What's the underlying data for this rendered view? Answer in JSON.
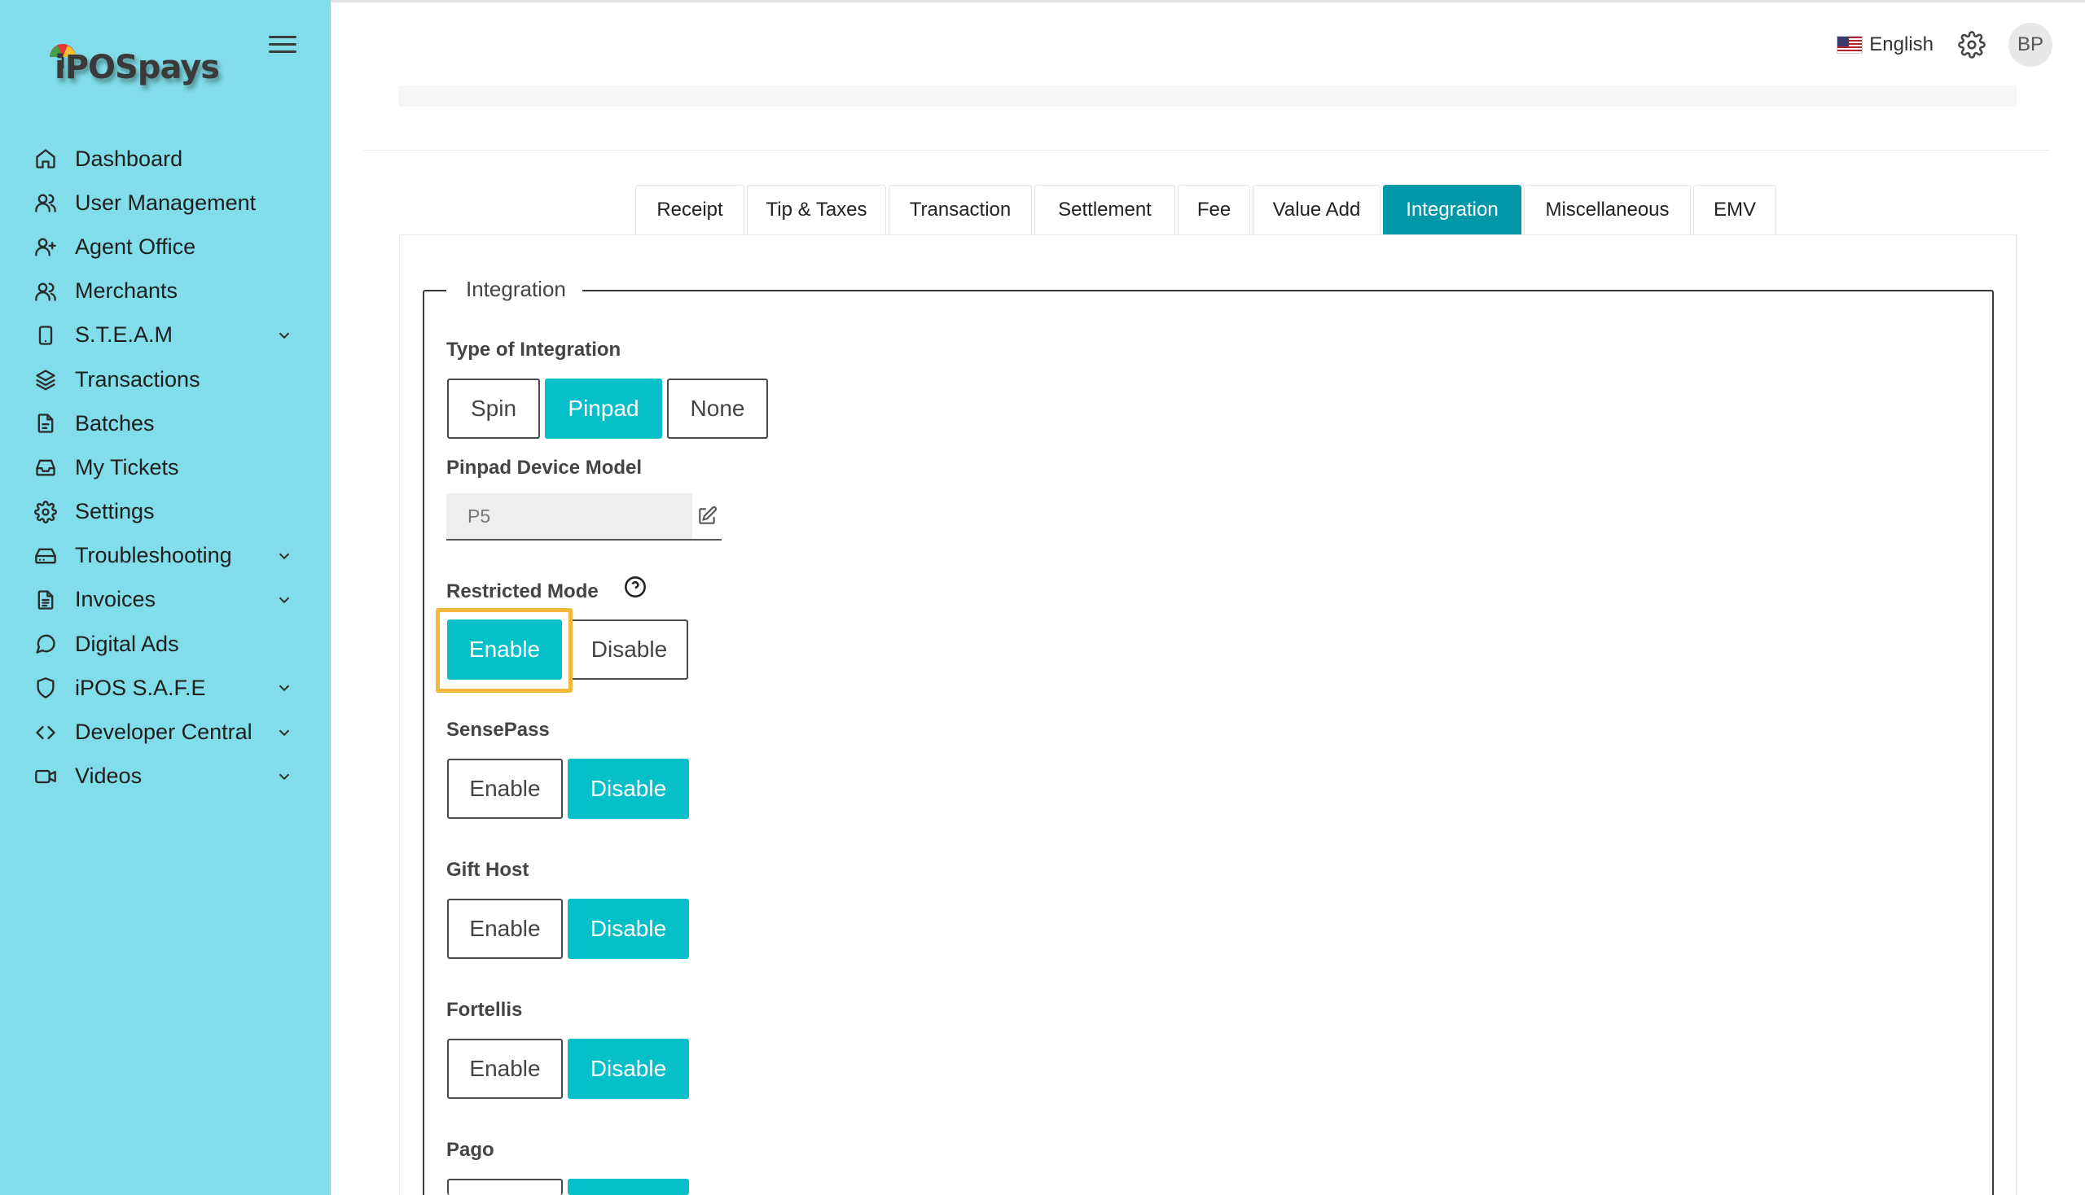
{
  "brand": {
    "logo_text": "iPOSpays"
  },
  "sidebar": {
    "items": [
      {
        "label": "Dashboard",
        "icon": "home-icon",
        "expandable": false
      },
      {
        "label": "User Management",
        "icon": "users-icon",
        "expandable": false
      },
      {
        "label": "Agent Office",
        "icon": "user-plus-icon",
        "expandable": false
      },
      {
        "label": "Merchants",
        "icon": "users-icon",
        "expandable": false
      },
      {
        "label": "S.T.E.A.M",
        "icon": "tablet-icon",
        "expandable": true
      },
      {
        "label": "Transactions",
        "icon": "layers-icon",
        "expandable": false
      },
      {
        "label": "Batches",
        "icon": "file-icon",
        "expandable": false
      },
      {
        "label": "My Tickets",
        "icon": "inbox-icon",
        "expandable": false
      },
      {
        "label": "Settings",
        "icon": "gear-icon",
        "expandable": false
      },
      {
        "label": "Troubleshooting",
        "icon": "hard-drive-icon",
        "expandable": true
      },
      {
        "label": "Invoices",
        "icon": "file-text-icon",
        "expandable": true
      },
      {
        "label": "Digital Ads",
        "icon": "message-circle-icon",
        "expandable": false
      },
      {
        "label": "iPOS S.A.F.E",
        "icon": "shield-icon",
        "expandable": true
      },
      {
        "label": "Developer Central",
        "icon": "code-icon",
        "expandable": true
      },
      {
        "label": "Videos",
        "icon": "video-icon",
        "expandable": true
      }
    ]
  },
  "header": {
    "language": "English",
    "avatar_initials": "BP"
  },
  "tabs": [
    {
      "label": "Receipt",
      "active": false
    },
    {
      "label": "Tip & Taxes",
      "active": false
    },
    {
      "label": "Transaction",
      "active": false
    },
    {
      "label": "Settlement",
      "active": false
    },
    {
      "label": "Fee",
      "active": false
    },
    {
      "label": "Value Add",
      "active": false
    },
    {
      "label": "Integration",
      "active": true
    },
    {
      "label": "Miscellaneous",
      "active": false
    },
    {
      "label": "EMV",
      "active": false
    }
  ],
  "integration": {
    "legend": "Integration",
    "type_label": "Type of Integration",
    "type_options": [
      "Spin",
      "Pinpad",
      "None"
    ],
    "type_selected": "Pinpad",
    "device_model_label": "Pinpad Device Model",
    "device_model_value": "P5",
    "restricted_mode": {
      "label": "Restricted Mode",
      "enable": "Enable",
      "disable": "Disable",
      "selected": "Enable"
    },
    "sensepass": {
      "label": "SensePass",
      "enable": "Enable",
      "disable": "Disable",
      "selected": "Disable"
    },
    "gift_host": {
      "label": "Gift Host",
      "enable": "Enable",
      "disable": "Disable",
      "selected": "Disable"
    },
    "fortellis": {
      "label": "Fortellis",
      "enable": "Enable",
      "disable": "Disable",
      "selected": "Disable"
    },
    "pago": {
      "label": "Pago"
    }
  },
  "colors": {
    "sidebar": "#80dde9",
    "active_tab": "#0199a9",
    "toggle_on": "#05c0c8",
    "highlight": "#f3b73a"
  }
}
